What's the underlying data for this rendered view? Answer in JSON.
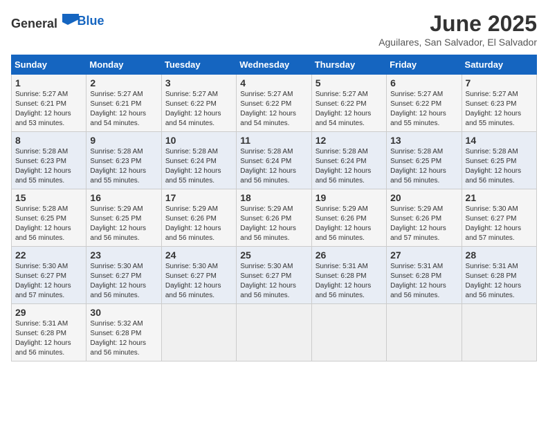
{
  "header": {
    "logo_general": "General",
    "logo_blue": "Blue",
    "month_title": "June 2025",
    "location": "Aguilares, San Salvador, El Salvador"
  },
  "days_of_week": [
    "Sunday",
    "Monday",
    "Tuesday",
    "Wednesday",
    "Thursday",
    "Friday",
    "Saturday"
  ],
  "weeks": [
    [
      {
        "day": "1",
        "sunrise": "5:27 AM",
        "sunset": "6:21 PM",
        "daylight": "12 hours and 53 minutes."
      },
      {
        "day": "2",
        "sunrise": "5:27 AM",
        "sunset": "6:21 PM",
        "daylight": "12 hours and 54 minutes."
      },
      {
        "day": "3",
        "sunrise": "5:27 AM",
        "sunset": "6:22 PM",
        "daylight": "12 hours and 54 minutes."
      },
      {
        "day": "4",
        "sunrise": "5:27 AM",
        "sunset": "6:22 PM",
        "daylight": "12 hours and 54 minutes."
      },
      {
        "day": "5",
        "sunrise": "5:27 AM",
        "sunset": "6:22 PM",
        "daylight": "12 hours and 54 minutes."
      },
      {
        "day": "6",
        "sunrise": "5:27 AM",
        "sunset": "6:22 PM",
        "daylight": "12 hours and 55 minutes."
      },
      {
        "day": "7",
        "sunrise": "5:27 AM",
        "sunset": "6:23 PM",
        "daylight": "12 hours and 55 minutes."
      }
    ],
    [
      {
        "day": "8",
        "sunrise": "5:28 AM",
        "sunset": "6:23 PM",
        "daylight": "12 hours and 55 minutes."
      },
      {
        "day": "9",
        "sunrise": "5:28 AM",
        "sunset": "6:23 PM",
        "daylight": "12 hours and 55 minutes."
      },
      {
        "day": "10",
        "sunrise": "5:28 AM",
        "sunset": "6:24 PM",
        "daylight": "12 hours and 55 minutes."
      },
      {
        "day": "11",
        "sunrise": "5:28 AM",
        "sunset": "6:24 PM",
        "daylight": "12 hours and 56 minutes."
      },
      {
        "day": "12",
        "sunrise": "5:28 AM",
        "sunset": "6:24 PM",
        "daylight": "12 hours and 56 minutes."
      },
      {
        "day": "13",
        "sunrise": "5:28 AM",
        "sunset": "6:25 PM",
        "daylight": "12 hours and 56 minutes."
      },
      {
        "day": "14",
        "sunrise": "5:28 AM",
        "sunset": "6:25 PM",
        "daylight": "12 hours and 56 minutes."
      }
    ],
    [
      {
        "day": "15",
        "sunrise": "5:28 AM",
        "sunset": "6:25 PM",
        "daylight": "12 hours and 56 minutes."
      },
      {
        "day": "16",
        "sunrise": "5:29 AM",
        "sunset": "6:25 PM",
        "daylight": "12 hours and 56 minutes."
      },
      {
        "day": "17",
        "sunrise": "5:29 AM",
        "sunset": "6:26 PM",
        "daylight": "12 hours and 56 minutes."
      },
      {
        "day": "18",
        "sunrise": "5:29 AM",
        "sunset": "6:26 PM",
        "daylight": "12 hours and 56 minutes."
      },
      {
        "day": "19",
        "sunrise": "5:29 AM",
        "sunset": "6:26 PM",
        "daylight": "12 hours and 56 minutes."
      },
      {
        "day": "20",
        "sunrise": "5:29 AM",
        "sunset": "6:26 PM",
        "daylight": "12 hours and 57 minutes."
      },
      {
        "day": "21",
        "sunrise": "5:30 AM",
        "sunset": "6:27 PM",
        "daylight": "12 hours and 57 minutes."
      }
    ],
    [
      {
        "day": "22",
        "sunrise": "5:30 AM",
        "sunset": "6:27 PM",
        "daylight": "12 hours and 57 minutes."
      },
      {
        "day": "23",
        "sunrise": "5:30 AM",
        "sunset": "6:27 PM",
        "daylight": "12 hours and 56 minutes."
      },
      {
        "day": "24",
        "sunrise": "5:30 AM",
        "sunset": "6:27 PM",
        "daylight": "12 hours and 56 minutes."
      },
      {
        "day": "25",
        "sunrise": "5:30 AM",
        "sunset": "6:27 PM",
        "daylight": "12 hours and 56 minutes."
      },
      {
        "day": "26",
        "sunrise": "5:31 AM",
        "sunset": "6:28 PM",
        "daylight": "12 hours and 56 minutes."
      },
      {
        "day": "27",
        "sunrise": "5:31 AM",
        "sunset": "6:28 PM",
        "daylight": "12 hours and 56 minutes."
      },
      {
        "day": "28",
        "sunrise": "5:31 AM",
        "sunset": "6:28 PM",
        "daylight": "12 hours and 56 minutes."
      }
    ],
    [
      {
        "day": "29",
        "sunrise": "5:31 AM",
        "sunset": "6:28 PM",
        "daylight": "12 hours and 56 minutes."
      },
      {
        "day": "30",
        "sunrise": "5:32 AM",
        "sunset": "6:28 PM",
        "daylight": "12 hours and 56 minutes."
      },
      null,
      null,
      null,
      null,
      null
    ]
  ]
}
